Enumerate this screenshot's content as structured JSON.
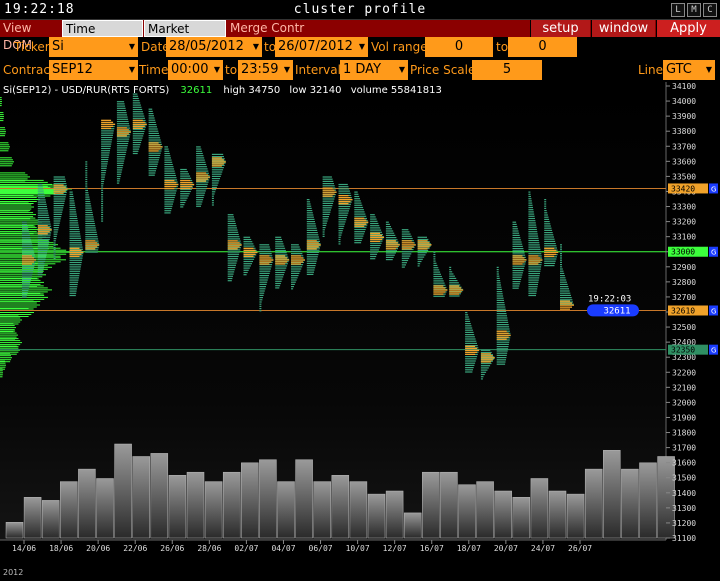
{
  "window": {
    "clock": "19:22:18",
    "title": "cluster profile",
    "buttons": [
      "L",
      "M",
      "C"
    ]
  },
  "menu": {
    "items": [
      "View DOM",
      "Time Interval",
      "Market Watch",
      "Merge Contr"
    ],
    "selected": "Time Interval",
    "actions": [
      "setup",
      "window",
      "Apply"
    ]
  },
  "controls": {
    "ticker_label": "Ticker",
    "ticker": "Si",
    "date_label": "Date",
    "date_from": "28/05/2012",
    "to_label": "to",
    "date_to": "26/07/2012",
    "vol_range_label": "Vol range",
    "vol_from": "0",
    "vol_to_label": "to",
    "vol_to": "0",
    "contract_label": "Contract",
    "contract": "SEP12",
    "time_label": "Time",
    "time_from": "00:00",
    "time_to_label": "to",
    "time_to": "23:59",
    "interval_label": "Interval",
    "interval": "1 DAY",
    "price_scale_label": "Price Scale",
    "price_scale": "5",
    "line_label": "Line",
    "line": "GTC"
  },
  "legend": {
    "symbol": "Si(SEP12) - USD/RUR(RTS FORTS)",
    "last": "32611",
    "high_label": "high",
    "high": "34750",
    "low_label": "low",
    "low": "32140",
    "volume_label": "volume",
    "volume": "55841813"
  },
  "colors": {
    "accent": "#ff9a1a",
    "menu_bg": "#8b0000",
    "profile_green": "#3cff3c",
    "cluster_teal": "#3aa57d",
    "poc_orange": "#f0a22a",
    "price_tag": "#1a3cff",
    "level_orange": "#c8782a",
    "level_green": "#3cff3c",
    "level_teal": "#2f8f63"
  },
  "chart_data": {
    "type": "cluster-profile",
    "y_range": [
      31100,
      34100
    ],
    "price_ticks": [
      34100,
      34000,
      33900,
      33800,
      33700,
      33600,
      33500,
      33400,
      33300,
      33200,
      33100,
      33000,
      32900,
      32800,
      32700,
      32600,
      32500,
      32400,
      32300,
      32200,
      32100,
      32000,
      31900,
      31800,
      31700,
      31600,
      31500,
      31400,
      31300,
      31200,
      31100
    ],
    "current_time": "19:22:03",
    "current_price": 32611,
    "levels": [
      {
        "price": 33420,
        "label": "33420",
        "color": "#c8782a",
        "tag": "G"
      },
      {
        "price": 33000,
        "label": "33000",
        "color": "#3cff3c",
        "tag": "G"
      },
      {
        "price": 32610,
        "label": "32610",
        "color": "#c8782a",
        "tag": "G"
      },
      {
        "price": 32350,
        "label": "32350",
        "color": "#2f8f63",
        "tag": "G"
      }
    ],
    "x_labels": [
      "14/06",
      "18/06",
      "20/06",
      "22/06",
      "26/06",
      "28/06",
      "02/07",
      "04/07",
      "06/07",
      "10/07",
      "12/07",
      "16/07",
      "18/07",
      "20/07",
      "24/07",
      "26/07"
    ],
    "year_label": "2012",
    "days": [
      {
        "low": 32700,
        "high": 33200,
        "poc": 32950,
        "vol": 2
      },
      {
        "low": 32850,
        "high": 33450,
        "poc": 33150,
        "vol": 5
      },
      {
        "low": 32950,
        "high": 33500,
        "poc": 33420,
        "vol": 5
      },
      {
        "low": 32700,
        "high": 33400,
        "poc": 33000,
        "vol": 8
      },
      {
        "low": 33000,
        "high": 33600,
        "poc": 33050,
        "vol": 9
      },
      {
        "low": 33200,
        "high": 33850,
        "poc": 33850,
        "vol": 12
      },
      {
        "low": 33450,
        "high": 34000,
        "poc": 33800,
        "vol": 14
      },
      {
        "low": 33650,
        "high": 34050,
        "poc": 33850,
        "vol": 10
      },
      {
        "low": 33500,
        "high": 33950,
        "poc": 33700,
        "vol": 10
      },
      {
        "low": 33250,
        "high": 33700,
        "poc": 33450,
        "vol": 8
      },
      {
        "low": 33300,
        "high": 33550,
        "poc": 33450,
        "vol": 10
      },
      {
        "low": 33300,
        "high": 33700,
        "poc": 33500,
        "vol": 8
      },
      {
        "low": 33300,
        "high": 33650,
        "poc": 33600,
        "vol": 11
      },
      {
        "low": 32800,
        "high": 33250,
        "poc": 33050,
        "vol": 12
      },
      {
        "low": 32850,
        "high": 33100,
        "poc": 33000,
        "vol": 9
      },
      {
        "low": 32600,
        "high": 33050,
        "poc": 32950,
        "vol": 9
      },
      {
        "low": 32750,
        "high": 33100,
        "poc": 32950,
        "vol": 4
      },
      {
        "low": 32750,
        "high": 33050,
        "poc": 32950,
        "vol": 9
      },
      {
        "low": 32850,
        "high": 33350,
        "poc": 33050,
        "vol": 9
      },
      {
        "low": 33100,
        "high": 33500,
        "poc": 33400,
        "vol": 7
      },
      {
        "low": 33050,
        "high": 33450,
        "poc": 33350,
        "vol": 7
      },
      {
        "low": 33050,
        "high": 33400,
        "poc": 33200,
        "vol": 6
      },
      {
        "low": 32950,
        "high": 33250,
        "poc": 33100,
        "vol": 7
      },
      {
        "low": 32950,
        "high": 33200,
        "poc": 33050,
        "vol": 7
      },
      {
        "low": 32900,
        "high": 33150,
        "poc": 33050,
        "vol": 5
      },
      {
        "low": 32900,
        "high": 33100,
        "poc": 33050,
        "vol": 5
      },
      {
        "low": 32700,
        "high": 33000,
        "poc": 32750,
        "vol": 9
      },
      {
        "low": 32700,
        "high": 32900,
        "poc": 32750,
        "vol": 7
      },
      {
        "low": 32200,
        "high": 32600,
        "poc": 32350,
        "vol": 7
      },
      {
        "low": 32150,
        "high": 32350,
        "poc": 32300,
        "vol": 9
      },
      {
        "low": 32250,
        "high": 32900,
        "poc": 32450,
        "vol": 3
      },
      {
        "low": 32750,
        "high": 33200,
        "poc": 32950,
        "vol": 11
      },
      {
        "low": 32700,
        "high": 33400,
        "poc": 32950,
        "vol": 9
      },
      {
        "low": 32900,
        "high": 33350,
        "poc": 33000,
        "vol": 10
      },
      {
        "low": 32650,
        "high": 33050,
        "poc": 32650,
        "vol": 9
      }
    ],
    "market_profile": [
      {
        "price": 34000,
        "w": 2
      },
      {
        "price": 33900,
        "w": 4
      },
      {
        "price": 33800,
        "w": 6
      },
      {
        "price": 33700,
        "w": 10
      },
      {
        "price": 33600,
        "w": 14
      },
      {
        "price": 33500,
        "w": 30
      },
      {
        "price": 33450,
        "w": 52
      },
      {
        "price": 33420,
        "w": 72
      },
      {
        "price": 33400,
        "w": 60
      },
      {
        "price": 33350,
        "w": 40
      },
      {
        "price": 33300,
        "w": 34
      },
      {
        "price": 33250,
        "w": 36
      },
      {
        "price": 33200,
        "w": 42
      },
      {
        "price": 33150,
        "w": 40
      },
      {
        "price": 33100,
        "w": 46
      },
      {
        "price": 33050,
        "w": 58
      },
      {
        "price": 33000,
        "w": 72
      },
      {
        "price": 32950,
        "w": 66
      },
      {
        "price": 32900,
        "w": 52
      },
      {
        "price": 32850,
        "w": 46
      },
      {
        "price": 32800,
        "w": 44
      },
      {
        "price": 32750,
        "w": 52
      },
      {
        "price": 32700,
        "w": 48
      },
      {
        "price": 32650,
        "w": 40
      },
      {
        "price": 32600,
        "w": 34
      },
      {
        "price": 32550,
        "w": 22
      },
      {
        "price": 32500,
        "w": 16
      },
      {
        "price": 32450,
        "w": 18
      },
      {
        "price": 32400,
        "w": 22
      },
      {
        "price": 32350,
        "w": 20
      },
      {
        "price": 32300,
        "w": 12
      },
      {
        "price": 32250,
        "w": 6
      },
      {
        "price": 32200,
        "w": 3
      }
    ],
    "volume_bars": [
      10,
      26,
      24,
      36,
      44,
      38,
      60,
      52,
      54,
      40,
      42,
      36,
      42,
      48,
      50,
      36,
      50,
      36,
      40,
      36,
      28,
      30,
      16,
      42,
      42,
      34,
      36,
      30,
      26,
      38,
      30,
      28,
      44,
      56,
      44,
      48,
      52
    ]
  }
}
